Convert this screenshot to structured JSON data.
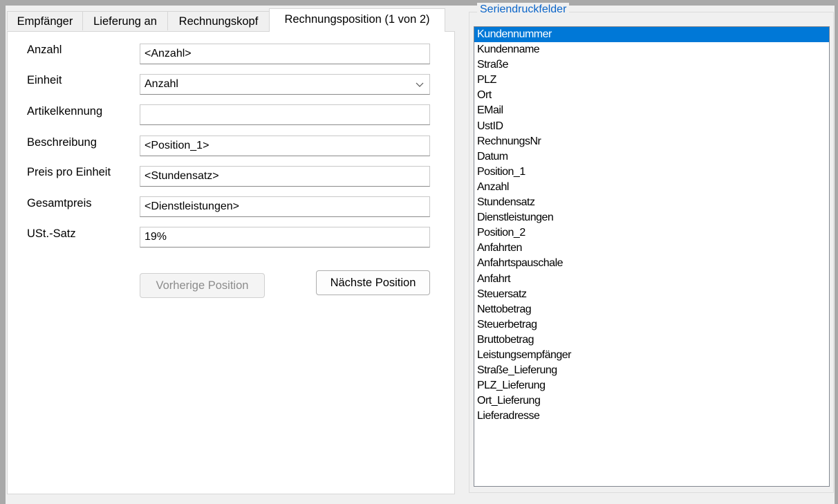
{
  "tabs": [
    {
      "label": "Empfänger"
    },
    {
      "label": "Lieferung an"
    },
    {
      "label": "Rechnungskopf"
    },
    {
      "label": "Rechnungsposition (1 von 2)",
      "active": true
    }
  ],
  "form": {
    "anzahl": {
      "label": "Anzahl",
      "value": "<Anzahl>"
    },
    "einheit": {
      "label": "Einheit",
      "value": "Anzahl"
    },
    "artikelkennung": {
      "label": "Artikelkennung",
      "value": ""
    },
    "beschreibung": {
      "label": "Beschreibung",
      "value": "<Position_1>"
    },
    "preis": {
      "label": "Preis pro Einheit",
      "value": "<Stundensatz>"
    },
    "gesamtpreis": {
      "label": "Gesamtpreis",
      "value": "<Dienstleistungen>"
    },
    "ust": {
      "label": "USt.-Satz",
      "value": "19%"
    }
  },
  "buttons": {
    "prev": "Vorherige Position",
    "next": "Nächste Position"
  },
  "fields_group": {
    "title": "Seriendruckfelder",
    "selected_index": 0,
    "items": [
      "Kundennummer",
      "Kundenname",
      "Straße",
      "PLZ",
      "Ort",
      "EMail",
      "UstID",
      "RechnungsNr",
      "Datum",
      "Position_1",
      "Anzahl",
      "Stundensatz",
      "Dienstleistungen",
      "Position_2",
      "Anfahrten",
      "Anfahrtspauschale",
      "Anfahrt",
      "Steuersatz",
      "Nettobetrag",
      "Steuerbetrag",
      "Bruttobetrag",
      "Leistungsempfänger",
      "Straße_Lieferung",
      "PLZ_Lieferung",
      "Ort_Lieferung",
      "Lieferadresse"
    ]
  },
  "colors": {
    "selection": "#0078d7",
    "group_title": "#0a64c8"
  }
}
